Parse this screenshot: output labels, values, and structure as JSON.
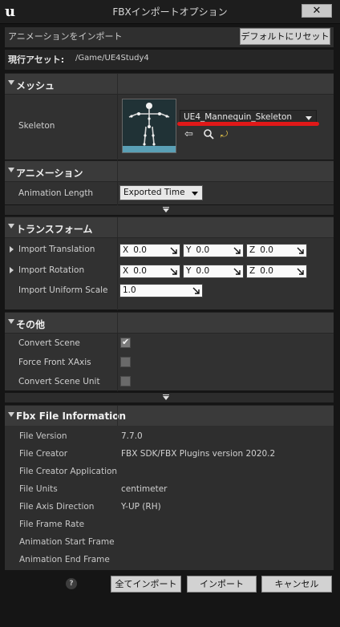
{
  "window": {
    "title": "FBXインポートオプション",
    "close_glyph": "✕",
    "logo_glyph": "u"
  },
  "header": {
    "import_label": "アニメーションをインポート",
    "reset_button": "デフォルトにリセット",
    "asset_label": "現行アセット:",
    "asset_path": "/Game/UE4Study4"
  },
  "mesh": {
    "title": "メッシュ",
    "skeleton_label": "Skeleton",
    "skeleton_value": "UE4_Mannequin_Skeleton",
    "skeleton_icons": [
      "arrow-left-icon",
      "search-icon",
      "reset-icon"
    ]
  },
  "animation": {
    "title": "アニメーション",
    "length_label": "Animation Length",
    "length_value": "Exported Time"
  },
  "transform": {
    "title": "トランスフォーム",
    "translation_label": "Import Translation",
    "translation": {
      "x_label": "X",
      "x": "0.0",
      "y_label": "Y",
      "y": "0.0",
      "z_label": "Z",
      "z": "0.0"
    },
    "rotation_label": "Import Rotation",
    "rotation": {
      "x_label": "X",
      "x": "0.0",
      "y_label": "Y",
      "y": "0.0",
      "z_label": "Z",
      "z": "0.0"
    },
    "scale_label": "Import Uniform Scale",
    "scale_value": "1.0"
  },
  "misc": {
    "title": "その他",
    "convert_scene_label": "Convert Scene",
    "convert_scene": true,
    "force_front_label": "Force Front XAxis",
    "force_front": false,
    "convert_unit_label": "Convert Scene Unit",
    "convert_unit": false
  },
  "fbx_info": {
    "title": "Fbx File Information",
    "rows": [
      {
        "label": "File Version",
        "value": "7.7.0"
      },
      {
        "label": "File Creator",
        "value": "FBX SDK/FBX Plugins version 2020.2"
      },
      {
        "label": "File Creator Application",
        "value": ""
      },
      {
        "label": "File Units",
        "value": "centimeter"
      },
      {
        "label": "File Axis Direction",
        "value": "Y-UP (RH)"
      },
      {
        "label": "File Frame Rate",
        "value": ""
      },
      {
        "label": "Animation Start Frame",
        "value": ""
      },
      {
        "label": "Animation End Frame",
        "value": ""
      }
    ]
  },
  "footer": {
    "help_glyph": "?",
    "import_all": "全てインポート",
    "import": "インポート",
    "cancel": "キャンセル"
  },
  "colors": {
    "annotation_underline": "#e01818"
  }
}
